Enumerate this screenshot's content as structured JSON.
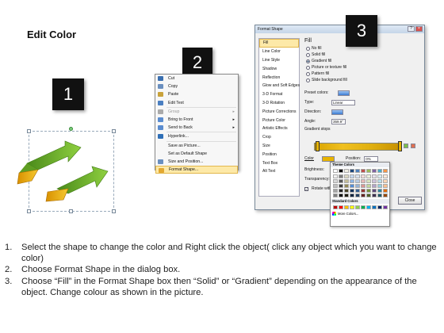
{
  "heading": "Edit Color",
  "steps": [
    "1",
    "2",
    "3"
  ],
  "context_menu": {
    "items": [
      {
        "label": "Cut",
        "icon": "scissors-icon",
        "color": "#3a6fb0"
      },
      {
        "label": "Copy",
        "icon": "copy-icon",
        "color": "#6a8fbf"
      },
      {
        "label": "Paste",
        "icon": "paste-icon",
        "color": "#c9a23a"
      },
      {
        "label": "Edit Text",
        "icon": "edit-text-icon",
        "color": "#4a7fc1"
      },
      {
        "label": "Group",
        "icon": "group-icon",
        "color": "#aaaaaa",
        "disabled": true,
        "submenu": true
      },
      {
        "label": "Bring to Front",
        "icon": "bring-front-icon",
        "color": "#5a8ccf",
        "submenu": true
      },
      {
        "label": "Send to Back",
        "icon": "send-back-icon",
        "color": "#5a8ccf",
        "submenu": true
      },
      {
        "label": "Hyperlink...",
        "icon": "hyperlink-icon",
        "color": "#2f6fb7"
      },
      {
        "label": "Save as Picture...",
        "icon": "",
        "color": ""
      },
      {
        "label": "Set as Default Shape",
        "icon": "",
        "color": ""
      },
      {
        "label": "Size and Position...",
        "icon": "size-position-icon",
        "color": "#6a8fbf"
      },
      {
        "label": "Format Shape...",
        "icon": "format-shape-icon",
        "color": "#e3a830",
        "highlighted": true
      }
    ]
  },
  "dialog": {
    "title": "Format Shape",
    "categories": [
      "Fill",
      "Line Color",
      "Line Style",
      "Shadow",
      "Reflection",
      "Glow and Soft Edges",
      "3-D Format",
      "3-D Rotation",
      "Picture Corrections",
      "Picture Color",
      "Artistic Effects",
      "Crop",
      "Size",
      "Position",
      "Text Box",
      "Alt Text"
    ],
    "selected_category": "Fill",
    "fill_heading": "Fill",
    "fill_options": [
      {
        "label": "No fill",
        "checked": false
      },
      {
        "label": "Solid fill",
        "checked": false
      },
      {
        "label": "Gradient fill",
        "checked": true
      },
      {
        "label": "Picture or texture fill",
        "checked": false
      },
      {
        "label": "Pattern fill",
        "checked": false
      },
      {
        "label": "Slide background fill",
        "checked": false
      }
    ],
    "preset_colors_label": "Preset colors:",
    "type_label": "Type:",
    "type_value": "Linear",
    "direction_label": "Direction:",
    "angle_label": "Angle:",
    "angle_value": "359.9°",
    "gradient_stops_label": "Gradient stops",
    "color_label": "Color",
    "position_label": "Position:",
    "position_value": "0%",
    "brightness_label": "Brightness:",
    "transparency_label": "Transparency:",
    "rotate_label": "Rotate with shape",
    "close_label": "Close",
    "gradient_color": "#e8b400"
  },
  "palette": {
    "theme_heading": "Theme Colors",
    "standard_heading": "Standard Colors",
    "more_label": "More Colors...",
    "theme_top": [
      "#ffffff",
      "#000000",
      "#eeece1",
      "#1f497d",
      "#4f81bd",
      "#c0504d",
      "#9bbb59",
      "#8064a2",
      "#4bacc6",
      "#f79646"
    ],
    "theme_shades": [
      [
        "#f2f2f2",
        "#7f7f7f",
        "#ddd9c3",
        "#c6d9f0",
        "#dbe5f1",
        "#f2dcdb",
        "#ebf1dd",
        "#e5e0ec",
        "#dbeef3",
        "#fdeada"
      ],
      [
        "#d8d8d8",
        "#595959",
        "#c4bd97",
        "#8db3e2",
        "#b8cce4",
        "#e5b9b7",
        "#d7e3bc",
        "#ccc1d9",
        "#b7dde8",
        "#fbd5b5"
      ],
      [
        "#bfbfbf",
        "#3f3f3f",
        "#938953",
        "#548dd4",
        "#95b3d7",
        "#d99694",
        "#c3d69b",
        "#b2a2c7",
        "#92cddc",
        "#fac08f"
      ],
      [
        "#a5a5a5",
        "#262626",
        "#494429",
        "#17365d",
        "#366092",
        "#953734",
        "#76923c",
        "#5f497a",
        "#31859b",
        "#e36c09"
      ],
      [
        "#7f7f7f",
        "#0c0c0c",
        "#1d1b10",
        "#0f243e",
        "#244061",
        "#632423",
        "#4f6128",
        "#3f3151",
        "#205867",
        "#974806"
      ]
    ],
    "standard": [
      "#c00000",
      "#ff0000",
      "#ffc000",
      "#ffff00",
      "#92d050",
      "#00b050",
      "#00b0f0",
      "#0070c0",
      "#002060",
      "#7030a0"
    ]
  },
  "instructions": [
    {
      "num": "1.",
      "text": "Select the shape to change the color and Right click the object( click any object which you want to change color)"
    },
    {
      "num": "2.",
      "text": "Choose Format Shape in the dialog box."
    },
    {
      "num": "3.",
      "text": "Choose “Fill” in the Format Shape box then “Solid” or “Gradient” depending on the appearance of the object. Change colour as shown in the picture."
    }
  ]
}
